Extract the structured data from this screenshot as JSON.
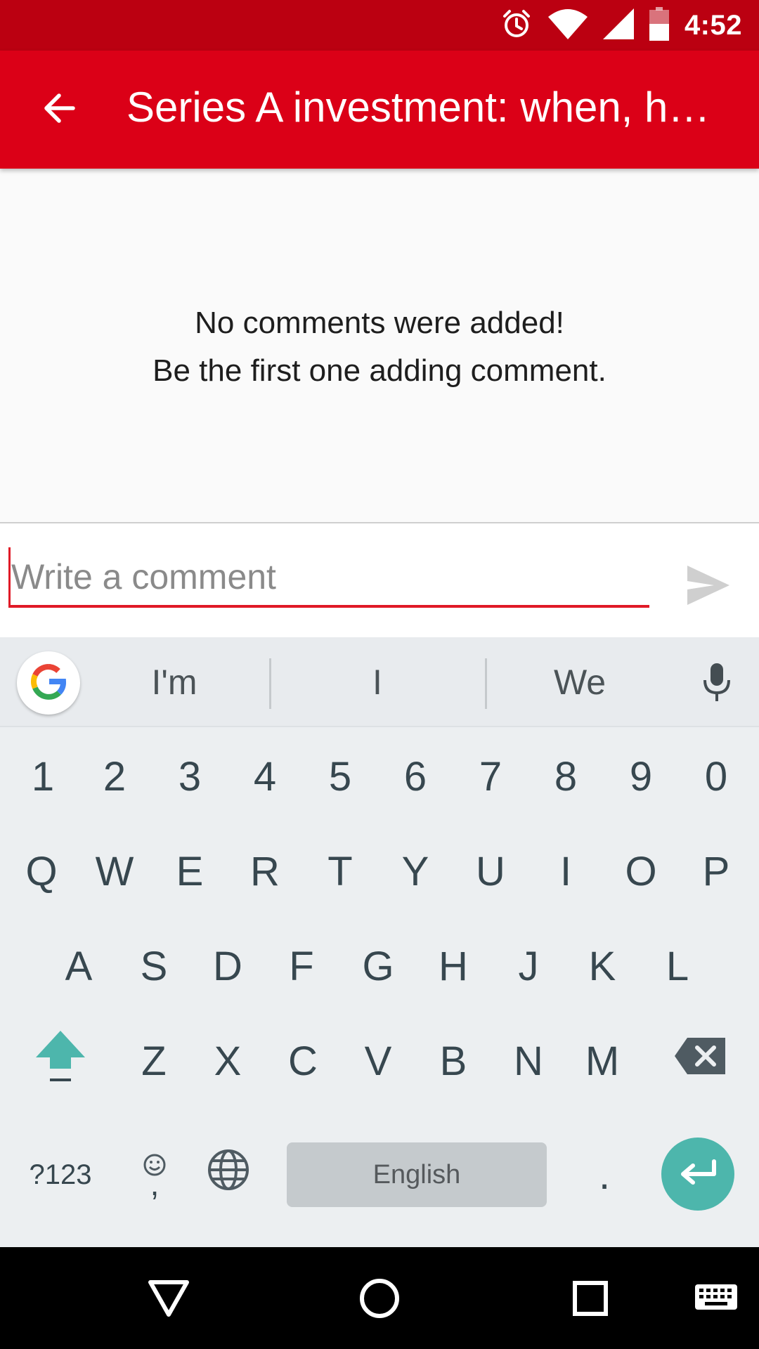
{
  "status_bar": {
    "time": "4:52",
    "icons": [
      "alarm-icon",
      "wifi-icon",
      "signal-icon",
      "battery-icon"
    ],
    "background": "#bb0011"
  },
  "app_bar": {
    "title": "Series A investment: when, how and why?",
    "back_icon": "arrow-back-icon",
    "background": "#db0017"
  },
  "empty_state": {
    "line1": "No comments were added!",
    "line2": "Be the first one adding comment."
  },
  "comment_bar": {
    "placeholder": "Write a comment",
    "value": "",
    "send_icon": "send-icon",
    "accent": "#e01a27"
  },
  "keyboard": {
    "suggestions": [
      "I'm",
      "I",
      "We"
    ],
    "number_row": [
      "1",
      "2",
      "3",
      "4",
      "5",
      "6",
      "7",
      "8",
      "9",
      "0"
    ],
    "row1": [
      "Q",
      "W",
      "E",
      "R",
      "T",
      "Y",
      "U",
      "I",
      "O",
      "P"
    ],
    "row2": [
      "A",
      "S",
      "D",
      "F",
      "G",
      "H",
      "J",
      "K",
      "L"
    ],
    "row3": [
      "Z",
      "X",
      "C",
      "V",
      "B",
      "N",
      "M"
    ],
    "symbols_key": "?123",
    "comma_key": ",",
    "space_label": "English",
    "period_key": ".",
    "enter_color": "#4db6ac"
  },
  "nav_bar": {
    "buttons": [
      "back-triangle-icon",
      "home-circle-icon",
      "recents-square-icon",
      "keyboard-icon"
    ]
  }
}
